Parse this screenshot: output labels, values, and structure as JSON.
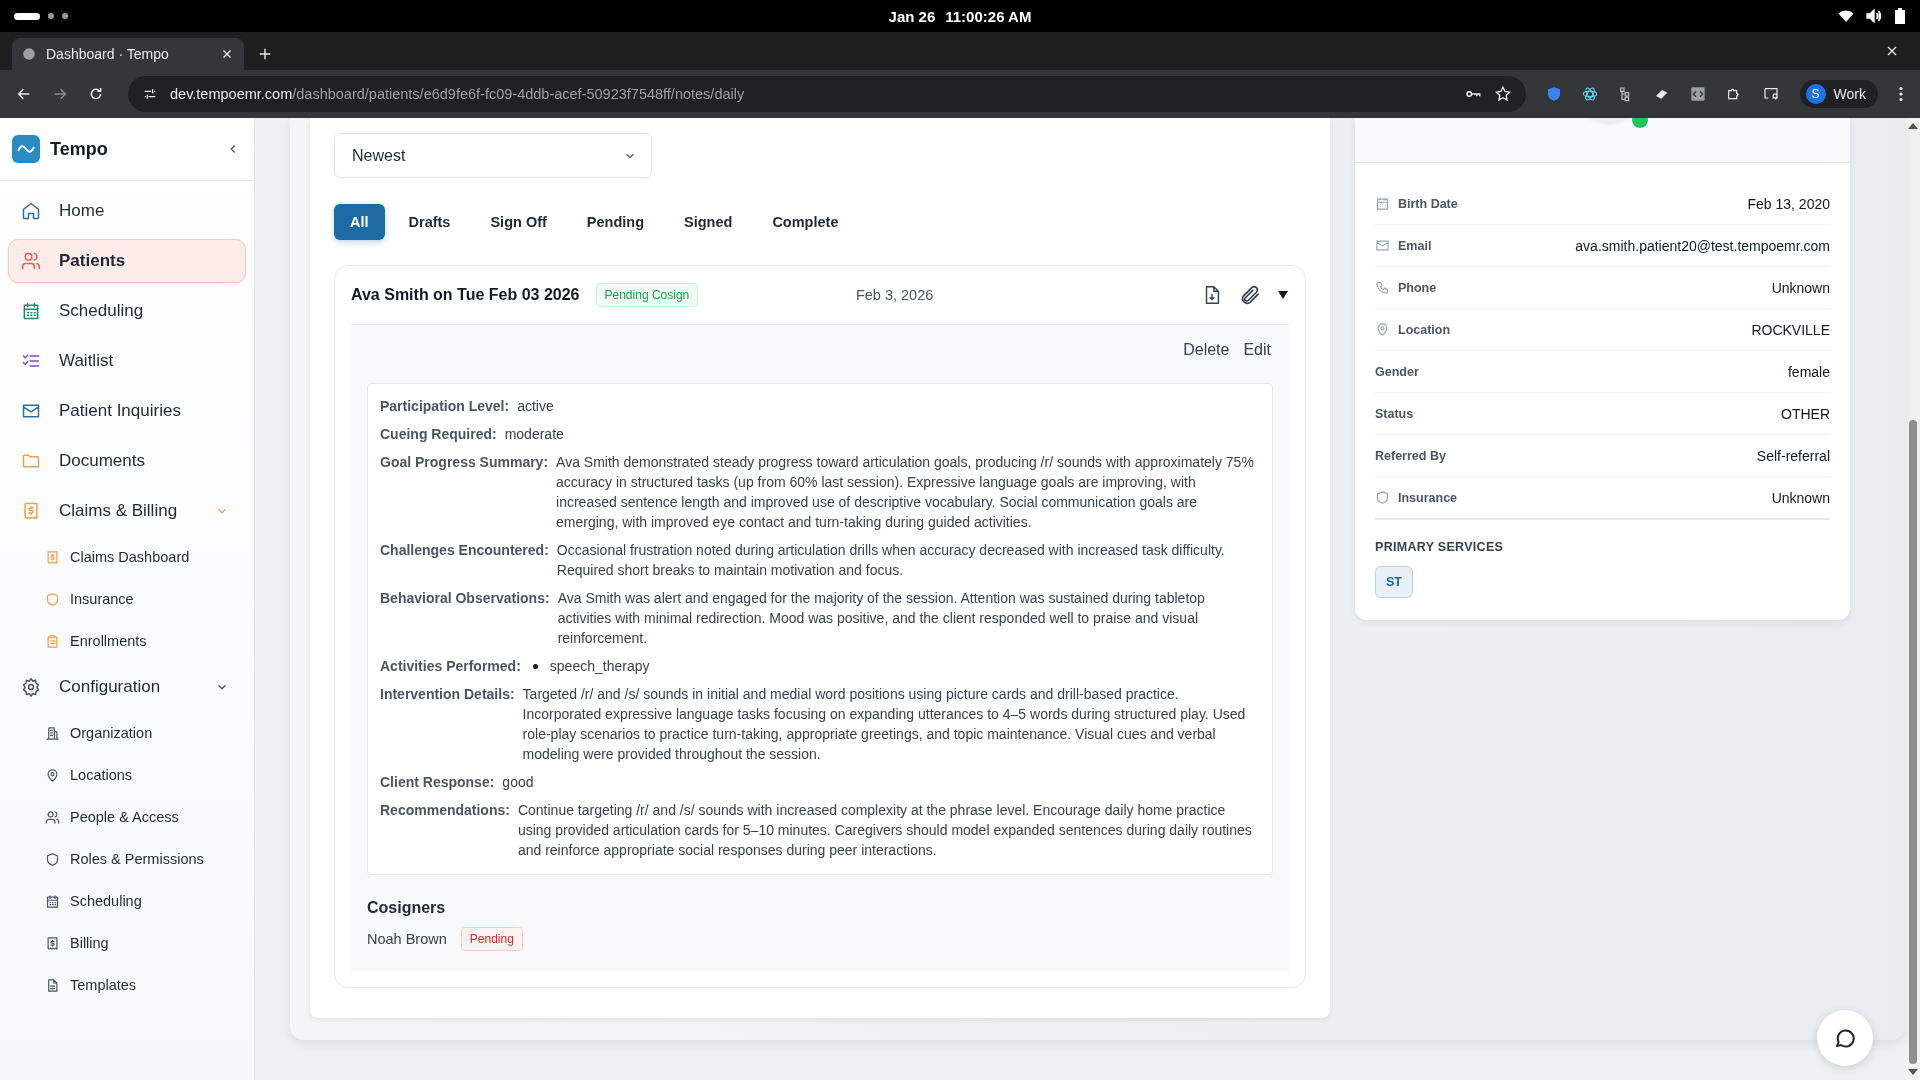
{
  "os": {
    "date": "Jan 26",
    "time": "11:00:26 AM"
  },
  "browser": {
    "tab": {
      "title": "Dashboard · Tempo"
    },
    "url_domain": "dev.tempoemr.com",
    "url_path": "/dashboard/patients/e6d9fe6f-fc09-4ddb-acef-50923f7548ff/notes/daily",
    "profile": {
      "initial": "S",
      "label": "Work"
    }
  },
  "sidebar": {
    "brand": "Tempo",
    "items": [
      {
        "label": "Home",
        "selected": false
      },
      {
        "label": "Patients",
        "selected": true
      },
      {
        "label": "Scheduling",
        "selected": false
      },
      {
        "label": "Waitlist",
        "selected": false
      },
      {
        "label": "Patient Inquiries",
        "selected": false
      },
      {
        "label": "Documents",
        "selected": false
      },
      {
        "label": "Claims & Billing",
        "selected": false,
        "expanded": true,
        "children": [
          {
            "label": "Claims Dashboard",
            "selected": false
          },
          {
            "label": "Insurance",
            "selected": false
          },
          {
            "label": "Enrollments",
            "selected": false
          }
        ]
      },
      {
        "label": "Configuration",
        "selected": false,
        "expanded": true,
        "children": [
          {
            "label": "Organization",
            "selected": false
          },
          {
            "label": "Locations",
            "selected": false
          },
          {
            "label": "People & Access",
            "selected": false
          },
          {
            "label": "Roles & Permissions",
            "selected": false
          },
          {
            "label": "Scheduling",
            "selected": false
          },
          {
            "label": "Billing",
            "selected": false
          },
          {
            "label": "Templates",
            "selected": false
          }
        ]
      }
    ]
  },
  "sort": {
    "value": "Newest"
  },
  "filter_tabs": [
    {
      "label": "All",
      "selected": true
    },
    {
      "label": "Drafts",
      "selected": false
    },
    {
      "label": "Sign Off",
      "selected": false
    },
    {
      "label": "Pending",
      "selected": false
    },
    {
      "label": "Signed",
      "selected": false
    },
    {
      "label": "Complete",
      "selected": false
    }
  ],
  "note": {
    "title": "Ava Smith on Tue Feb 03 2026",
    "badge": {
      "text": "Pending Cosign",
      "kind": "success"
    },
    "date": "Feb 3, 2026",
    "expanded": true,
    "actions": [
      "Delete",
      "Edit"
    ],
    "fields": [
      {
        "kind": "text",
        "label": "Participation Level:",
        "value": "active"
      },
      {
        "kind": "text",
        "label": "Cueing Required:",
        "value": "moderate"
      },
      {
        "kind": "text",
        "label": "Goal Progress Summary:",
        "value": "Ava Smith demonstrated steady progress toward articulation goals, producing /r/ sounds with approximately 75% accuracy in structured tasks (up from 60% last session). Expressive language goals are improving, with increased sentence length and improved use of descriptive vocabulary. Social communication goals are emerging, with improved eye contact and turn-taking during guided activities."
      },
      {
        "kind": "text",
        "label": "Challenges Encountered:",
        "value": "Occasional frustration noted during articulation drills when accuracy decreased with increased task difficulty. Required short breaks to maintain motivation and focus."
      },
      {
        "kind": "text",
        "label": "Behavioral Observations:",
        "value": "Ava Smith was alert and engaged for the majority of the session. Attention was sustained during tabletop activities with minimal redirection. Mood was positive, and the client responded well to praise and visual reinforcement."
      },
      {
        "kind": "list",
        "label": "Activities Performed:",
        "items": [
          "speech_therapy"
        ]
      },
      {
        "kind": "text",
        "label": "Intervention Details:",
        "value": "Targeted /r/ and /s/ sounds in initial and medial word positions using picture cards and drill-based practice. Incorporated expressive language tasks focusing on expanding utterances to 4–5 words during structured play. Used role-play scenarios to practice turn-taking, appropriate greetings, and topic maintenance. Visual cues and verbal modeling were provided throughout the session."
      },
      {
        "kind": "text",
        "label": "Client Response:",
        "value": "good"
      },
      {
        "kind": "text",
        "label": "Recommendations:",
        "value": "Continue targeting /r/ and /s/ sounds with increased complexity at the phrase level. Encourage daily home practice using provided articulation cards for 5–10 minutes. Caregivers should model expanded sentences during daily routines and reinforce appropriate social responses during peer interactions."
      }
    ],
    "cosigners_title": "Cosigners",
    "cosigners": [
      {
        "name": "Noah Brown",
        "badge": {
          "text": "Pending",
          "kind": "danger"
        }
      }
    ]
  },
  "patient": {
    "online": true,
    "details": [
      {
        "label": "Birth Date",
        "value": "Feb 13, 2020"
      },
      {
        "label": "Email",
        "value": "ava.smith.patient20@test.tempoemr.com"
      },
      {
        "label": "Phone",
        "value": "Unknown"
      },
      {
        "label": "Location",
        "value": "ROCKVILLE"
      },
      {
        "label": "Gender",
        "value": "female"
      },
      {
        "label": "Status",
        "value": "OTHER"
      },
      {
        "label": "Referred By",
        "value": "Self-referral"
      },
      {
        "label": "Insurance",
        "value": "Unknown"
      }
    ],
    "services_title": "PRIMARY SERVICES",
    "services": [
      "ST"
    ]
  }
}
